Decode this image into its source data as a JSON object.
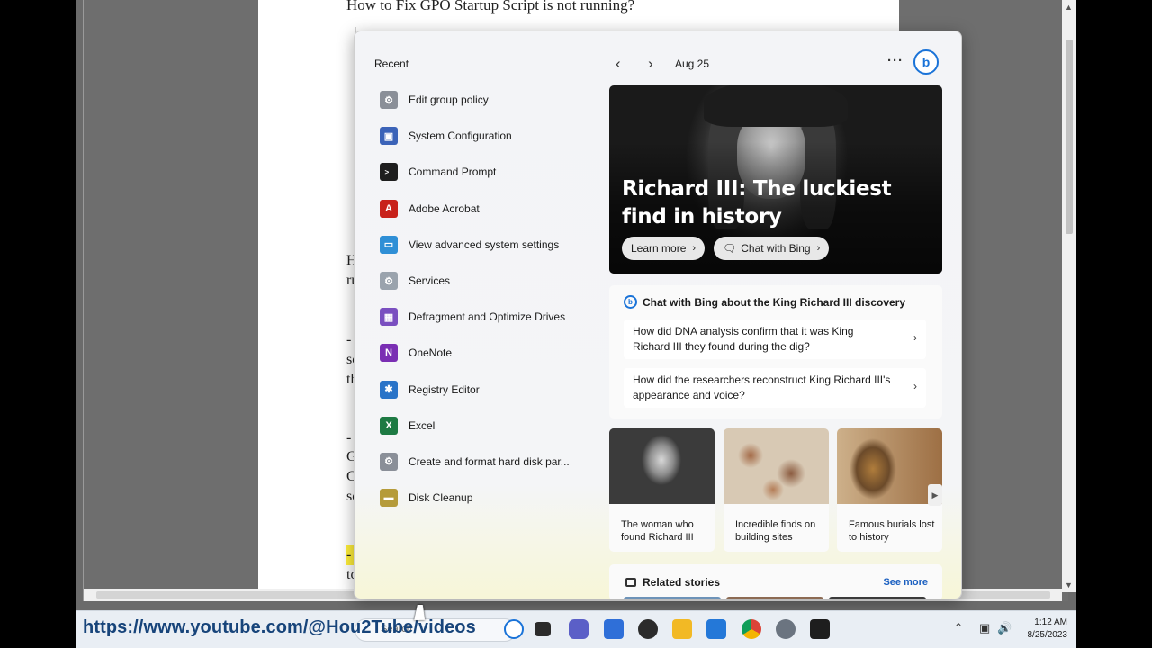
{
  "document": {
    "title": "How to Fix GPO Startup Script is not running?",
    "fragments": [
      "He",
      "ru",
      "- C",
      "scr",
      "the",
      "- V",
      "Gr",
      "Co",
      "scr",
      "- C",
      "to"
    ]
  },
  "widgets": {
    "recent_heading": "Recent",
    "date": "Aug 25",
    "more_label": "···",
    "recent_items": [
      {
        "label": "Edit group policy",
        "icon": "group-policy-icon",
        "color": "#8a8f98"
      },
      {
        "label": "System Configuration",
        "icon": "system-config-icon",
        "color": "#3b63b8"
      },
      {
        "label": "Command Prompt",
        "icon": "command-prompt-icon",
        "color": "#1e1e1e"
      },
      {
        "label": "Adobe Acrobat",
        "icon": "acrobat-icon",
        "color": "#c8221b"
      },
      {
        "label": "View advanced system settings",
        "icon": "monitor-icon",
        "color": "#2f8fd6"
      },
      {
        "label": "Services",
        "icon": "services-gear-icon",
        "color": "#9aa3ad"
      },
      {
        "label": "Defragment and Optimize Drives",
        "icon": "defrag-icon",
        "color": "#7a4fc0"
      },
      {
        "label": "OneNote",
        "icon": "onenote-icon",
        "color": "#7a2fb3"
      },
      {
        "label": "Registry Editor",
        "icon": "registry-icon",
        "color": "#2a74c8"
      },
      {
        "label": "Excel",
        "icon": "excel-icon",
        "color": "#1d7a43"
      },
      {
        "label": "Create and format hard disk par...",
        "icon": "disk-management-icon",
        "color": "#8a8f98"
      },
      {
        "label": "Disk Cleanup",
        "icon": "disk-cleanup-icon",
        "color": "#b59b3a"
      }
    ],
    "hero": {
      "title": "Richard III: The luckiest find in history",
      "learn_more": "Learn more",
      "chat_with_bing": "Chat with Bing"
    },
    "chat_card": {
      "heading": "Chat with Bing about the King Richard III discovery",
      "questions": [
        "How did DNA analysis confirm that it was King Richard III they found during the dig?",
        "How did the researchers reconstruct King Richard III's appearance and voice?"
      ]
    },
    "stories": [
      {
        "caption": "The woman who found Richard III"
      },
      {
        "caption": "Incredible finds on building sites"
      },
      {
        "caption": "Famous burials lost to history"
      }
    ],
    "related": {
      "title": "Related stories",
      "see_more": "See more"
    }
  },
  "taskbar": {
    "overlay_url": "https://www.youtube.com/@Hou2Tube/videos",
    "search_placeholder": "Search",
    "time": "1:12 AM",
    "date": "8/25/2023",
    "apps": [
      {
        "icon": "bing-icon",
        "color": "#1a73d8"
      },
      {
        "icon": "task-view-icon",
        "color": "#2b2b2b"
      },
      {
        "icon": "chat-teams-icon",
        "color": "#5b5fc7"
      },
      {
        "icon": "store-icon",
        "color": "#2f6fd8"
      },
      {
        "icon": "media-player-icon",
        "color": "#2b2b2b"
      },
      {
        "icon": "file-explorer-icon",
        "color": "#f2b925"
      },
      {
        "icon": "blue-app-icon",
        "color": "#2478d8"
      },
      {
        "icon": "chrome-icon",
        "color": "#db4437"
      },
      {
        "icon": "settings-icon",
        "color": "#6b7480"
      },
      {
        "icon": "terminal-icon",
        "color": "#1e1e1e"
      }
    ]
  }
}
